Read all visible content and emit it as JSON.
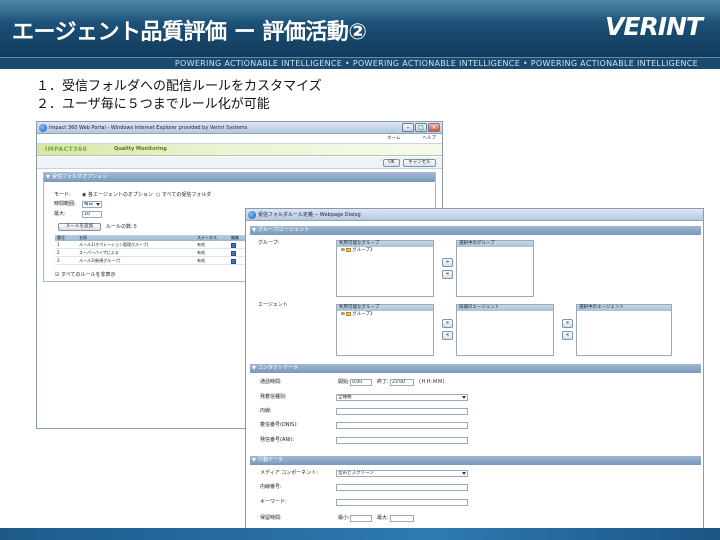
{
  "slide": {
    "title": "エージェント品質評価 ー 評価活動②",
    "logo": "VERINT",
    "tagline": "POWERING ACTIONABLE INTELLIGENCE • POWERING ACTIONABLE INTELLIGENCE • POWERING ACTIONABLE INTELLIGENCE",
    "bullets": [
      "１．受信フォルダへの配信ルールをカスタマイズ",
      "２．ユーザ毎に５つまでルール化が可能"
    ]
  },
  "window1": {
    "title": "Impact 360 Web Portal - Windows Internet Explorer provided by Verint Systems",
    "nav": {
      "home": "ホーム",
      "help": "ヘルプ"
    },
    "brand": "IMPACT360",
    "module": "Quality Monitoring",
    "buttons": {
      "ok": "OK",
      "cancel": "キャンセル"
    },
    "panel_title": "受信フォルダオプション",
    "mode_label": "モード:",
    "mode_option_1": "各エージェントのオプション",
    "mode_option_2": "すべての受信フォルダ",
    "period_label": "時間範囲:",
    "period_value": "毎日",
    "max_label": "最大:",
    "max_value": "10",
    "add_rule_button": "ルールを追加",
    "rule_count_label": "ルールの数:５",
    "table": {
      "headers": [
        "番号",
        "名前",
        "ステータス",
        "編集",
        "削除"
      ],
      "rows": [
        {
          "no": "1",
          "name": "ルール1(オペレーション管理グループ)",
          "status": "有効"
        },
        {
          "no": "2",
          "name": "スーパーバイザによる",
          "status": "有効"
        },
        {
          "no": "3",
          "name": "ルール3(新規グループ)",
          "status": "有効"
        }
      ]
    },
    "footer_check": "すべてのルールを非表示"
  },
  "window2": {
    "title": "受信フォルダルール定義 -- Webpage Dialog",
    "section1": "グループ/エージェント",
    "group_label": "グループ:",
    "group_available": "利用可能なグループ",
    "group_selected": "選択中のグループ",
    "group_tree_item": "グループ1",
    "agent_label": "エージェント",
    "agent_available": "利用可能なグループ",
    "agent_candidates": "候補のエージェント",
    "agent_selected": "選択中のエージェント",
    "agent_tree_item": "グループ1",
    "section2": "コンタクトデータ",
    "date_range_label": "通話時間:",
    "start_label": "開始:",
    "start_value": "0:00",
    "end_label": "終了:",
    "end_value": "23:00",
    "time_unit": "(ＨＨ:ＭＭ)",
    "direction_label": "発着信種別:",
    "direction_value": "全種類",
    "caller_label": "内線:",
    "dialed_label": "着信番号(DNIS):",
    "ani_label": "発信番号(ANI):",
    "section3": "行動データ",
    "media_label": "メディア コンポーネント:",
    "media_value": "音声とスクリーン",
    "extension_label": "内線番号:",
    "keyword_label": "キーワード:",
    "duration_label": "保留時間:",
    "min_label": "最小:",
    "max_label": "最大:"
  }
}
